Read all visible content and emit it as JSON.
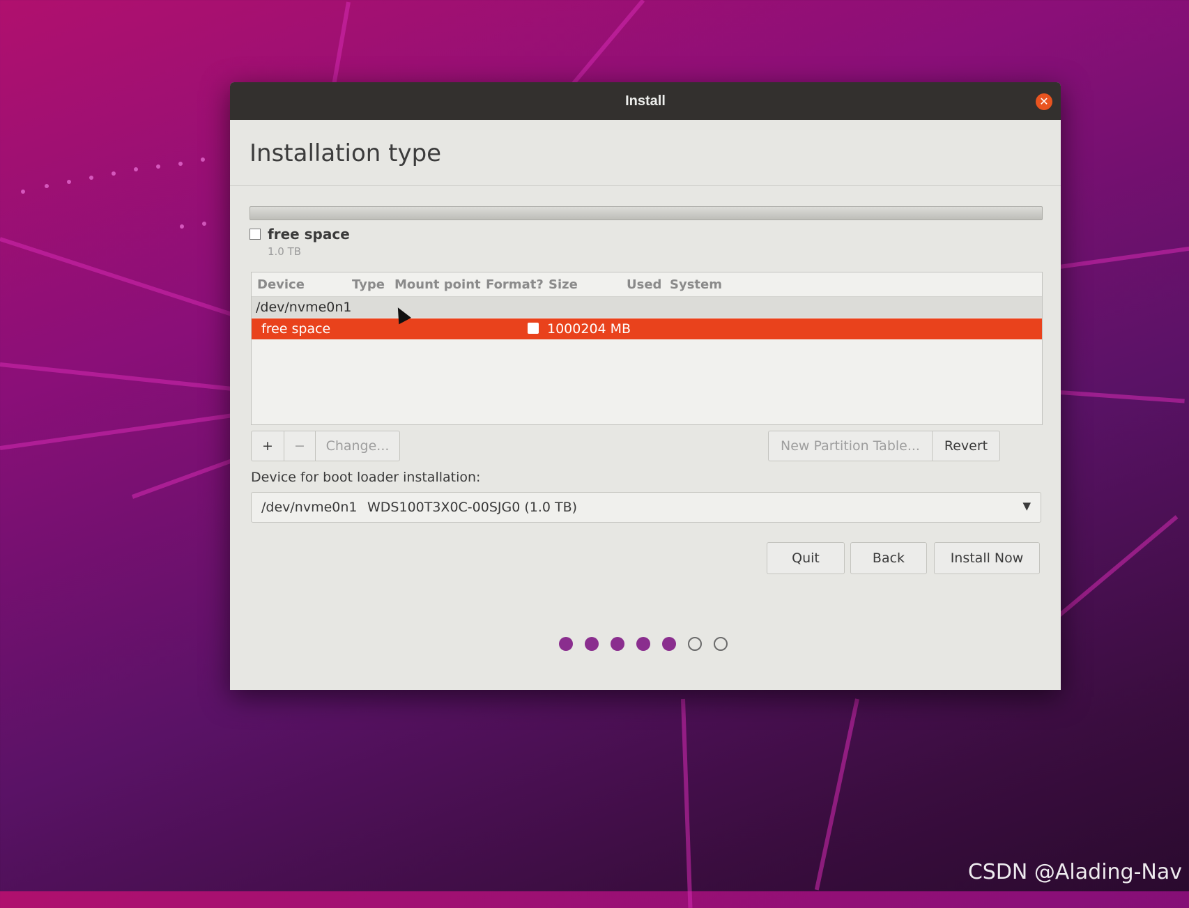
{
  "window": {
    "title": "Install"
  },
  "page": {
    "heading": "Installation type"
  },
  "disk_legend": {
    "name": "free space",
    "size": "1.0 TB"
  },
  "partition_table": {
    "columns": [
      "Device",
      "Type",
      "Mount point",
      "Format?",
      "Size",
      "Used",
      "System"
    ],
    "device_row": "/dev/nvme0n1",
    "selected_row": {
      "device": "free space",
      "size": "1000204 MB",
      "format_checked": false
    }
  },
  "toolbar": {
    "add_label": "+",
    "remove_label": "−",
    "change_label": "Change...",
    "new_table_label": "New Partition Table...",
    "revert_label": "Revert"
  },
  "boot_loader": {
    "label": "Device for boot loader installation:",
    "device": "/dev/nvme0n1",
    "model": "WDS100T3X0C-00SJG0 (1.0 TB)"
  },
  "buttons": {
    "quit": "Quit",
    "back": "Back",
    "install": "Install Now"
  },
  "progress": {
    "completed_steps": 5,
    "total_steps": 7
  },
  "watermark": "CSDN @Alading-Nav",
  "colors": {
    "accent": "#e9421c",
    "progress_dot": "#8a2e8e",
    "close": "#e95420"
  }
}
